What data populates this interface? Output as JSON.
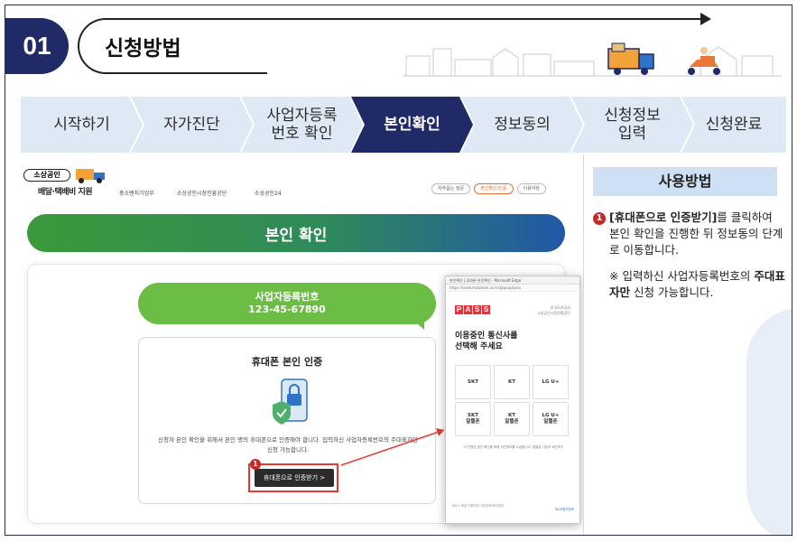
{
  "header": {
    "step_number": "01",
    "title": "신청방법"
  },
  "steps": [
    {
      "label": "시작하기",
      "active": false
    },
    {
      "label": "자가진단",
      "active": false
    },
    {
      "label": "사업자등록\n번호 확인",
      "active": false
    },
    {
      "label": "본인확인",
      "active": true
    },
    {
      "label": "정보동의",
      "active": false
    },
    {
      "label": "신청정보\n입력",
      "active": false
    },
    {
      "label": "신청완료",
      "active": false
    }
  ],
  "colors": {
    "step_inactive": "#dfe9f5",
    "step_active": "#1f2a66",
    "accent_green": "#6cbd45",
    "highlight_red": "#e53935"
  },
  "site": {
    "brand_badge": "소상공인",
    "brand_sub": "배달·택배비 지원",
    "ministry_1": "중소벤처기업부",
    "ministry_2": "소상공인시장진흥공단",
    "ministry_3": "소상공인24",
    "top_links": [
      "자주묻는 질문",
      "본인확인/인증",
      "이용약관"
    ],
    "page_heading": "본인 확인",
    "biz_label": "사업자등록번호",
    "biz_number": "123-45-67890",
    "auth_title": "휴대폰 본인 인증",
    "auth_desc": "신청자 본인 확인을 위해서 본인 명의 휴대폰으로 인증해야 합니다. 입력하신 사업자등록번호의 주대표자만 신청 가능합니다.",
    "auth_button": "휴대폰으로 인증받기 >",
    "marker": "1"
  },
  "popup": {
    "title_bar": "본인확인 | 휴대폰 본인확인 - Microsoft Edge",
    "url": "https://www.mobileok.co.kr/popup/pass",
    "logo_letters": [
      "P",
      "A",
      "S",
      "S"
    ],
    "corp": "한국도로공사\n소상공인시장진흥공단",
    "question": "이용중인 통신사를\n선택해 주세요",
    "carriers": [
      "SKT",
      "KT",
      "LG U+",
      "SKT\n알뜰폰",
      "KT\n알뜰폰",
      "LG U+\n알뜰폰"
    ],
    "note": "이 인증은 본인 확인을 위해 개인정보를 수집합니다. 알뜰폰 사업자 확인하기",
    "footer_left": "서비스 제공 이용약관 개인정보처리방침",
    "footer_right": "NICE평가정보"
  },
  "usage": {
    "title": "사용방법",
    "num": "1",
    "text_bold": "[휴대폰으로 인증받기]",
    "text_rest": "를 클릭하여 본인 확인을 진행한 뒤 정보동의 단계로 이동합니다.",
    "note_prefix": "※ 입력하신 사업자등록번호의 ",
    "note_bold": "주대표자만",
    "note_suffix": " 신청 가능합니다."
  }
}
